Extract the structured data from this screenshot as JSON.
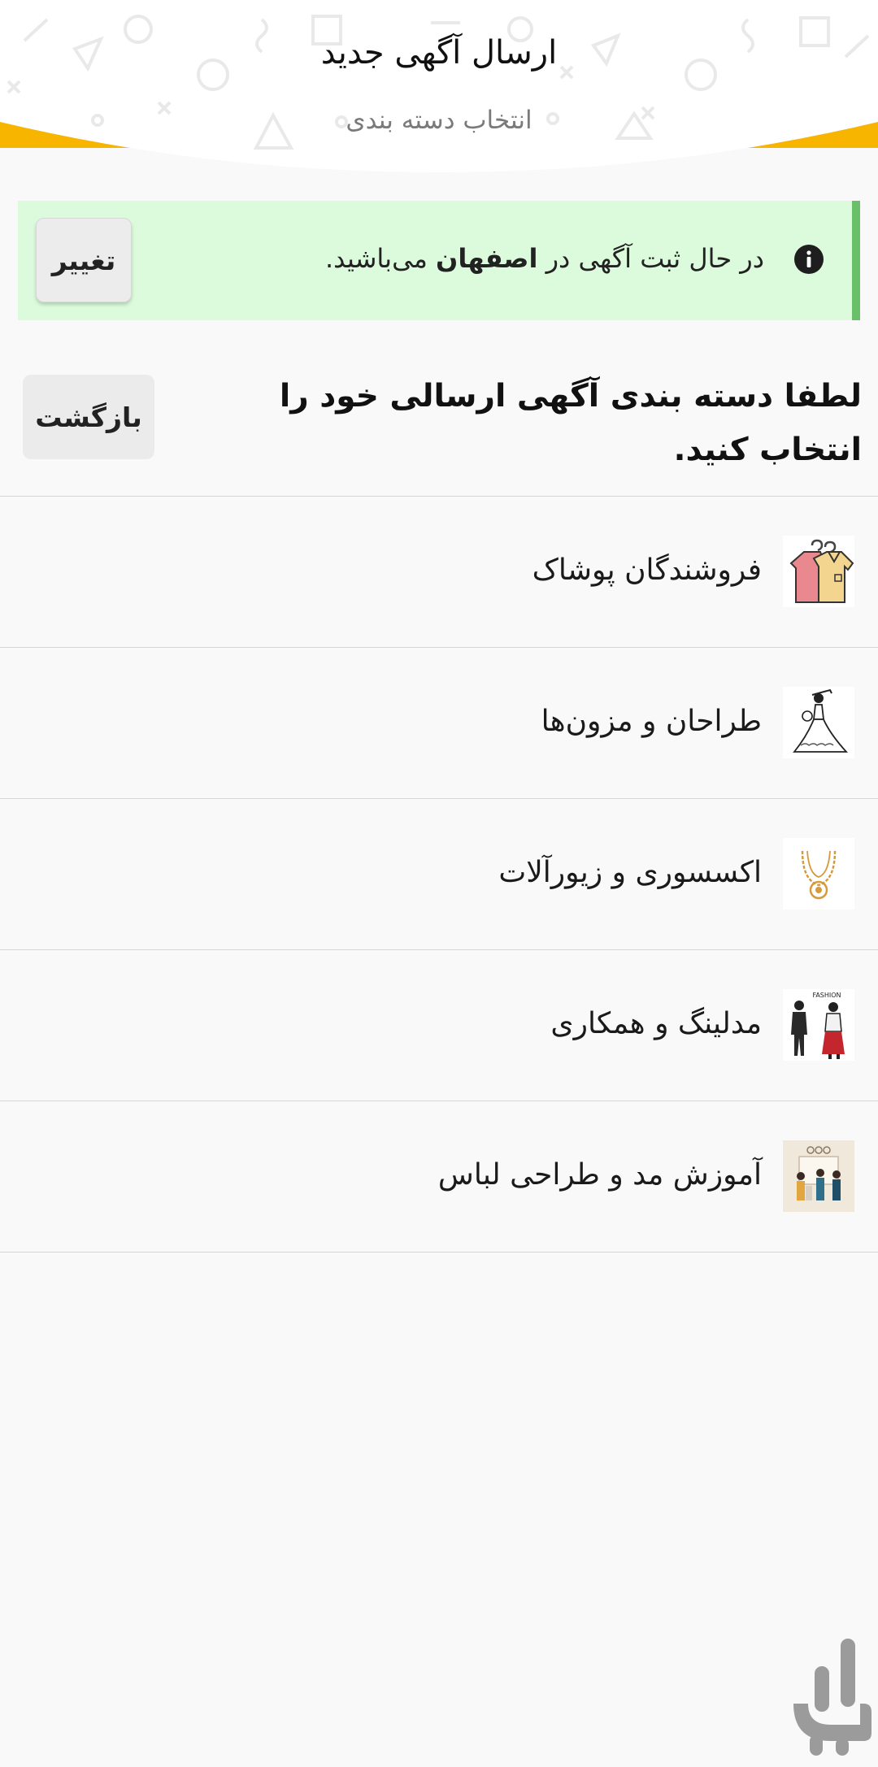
{
  "header": {
    "title": "ارسال آگهی جدید",
    "subtitle": "انتخاب دسته بندی"
  },
  "banner": {
    "text_before": "در حال ثبت آگهی در",
    "city": "اصفهان",
    "text_after": "می‌باشید.",
    "change_label": "تغییر",
    "icon": "info-icon"
  },
  "instruction": {
    "text": "لطفا دسته بندی آگهی ارسالی خود را انتخاب کنید.",
    "back_label": "بازگشت"
  },
  "categories": [
    {
      "label": "فروشندگان پوشاک",
      "icon": "clothing-icon"
    },
    {
      "label": "طراحان و مزون‌ها",
      "icon": "wedding-dress-icon"
    },
    {
      "label": "اکسسوری و زیورآلات",
      "icon": "necklace-icon"
    },
    {
      "label": "مدلینگ و همکاری",
      "icon": "fashion-models-icon",
      "thumb_text": "FASHION"
    },
    {
      "label": "آموزش مد و طراحی لباس",
      "icon": "fashion-class-icon"
    }
  ],
  "colors": {
    "accent_yellow": "#f7b500",
    "banner_bg": "#dcfbdc",
    "banner_border": "#6abf69",
    "page_bg": "#f9f9f9"
  },
  "watermark": {
    "icon": "app-store-logo-icon"
  }
}
